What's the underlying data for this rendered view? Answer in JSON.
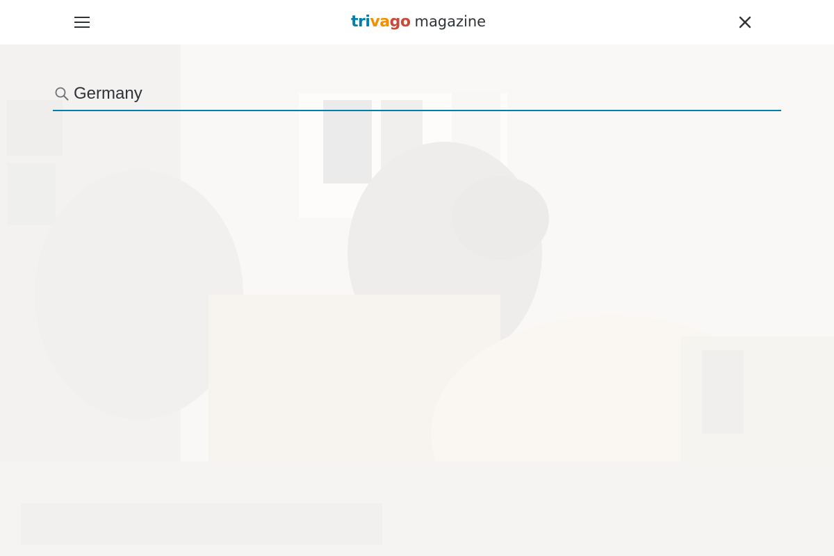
{
  "header": {
    "logo": {
      "brand_part1": "tri",
      "brand_part2": "va",
      "brand_part3": "go",
      "word": "magazine"
    }
  },
  "search": {
    "value": "Germany",
    "placeholder": ""
  },
  "icons": {
    "menu": "hamburger-menu-icon",
    "close": "close-icon",
    "search": "search-icon"
  },
  "colors": {
    "accent": "#007fad",
    "logo_blue": "#007fad",
    "logo_orange": "#f48f00",
    "logo_red": "#c94a38",
    "text": "#2d3339"
  }
}
